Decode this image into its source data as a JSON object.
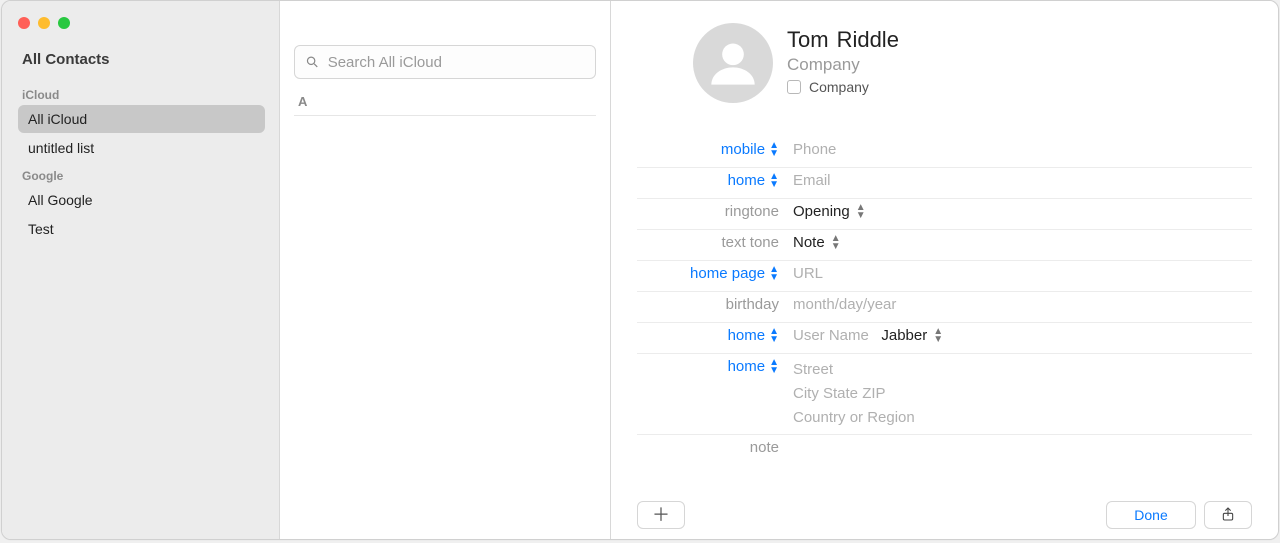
{
  "sidebar": {
    "title": "All Contacts",
    "groups": [
      {
        "name": "iCloud",
        "items": [
          {
            "label": "All iCloud",
            "selected": true
          },
          {
            "label": "untitled list",
            "selected": false
          }
        ]
      },
      {
        "name": "Google",
        "items": [
          {
            "label": "All Google",
            "selected": false
          },
          {
            "label": "Test",
            "selected": false
          }
        ]
      }
    ]
  },
  "search": {
    "placeholder": "Search All iCloud"
  },
  "list": {
    "letter": "A"
  },
  "contact": {
    "first_name": "Tom",
    "last_name": "Riddle",
    "company_placeholder": "Company",
    "is_company_label": "Company",
    "fields": {
      "phone": {
        "label": "mobile",
        "placeholder": "Phone"
      },
      "email": {
        "label": "home",
        "placeholder": "Email"
      },
      "ringtone": {
        "label": "ringtone",
        "value": "Opening"
      },
      "texttone": {
        "label": "text tone",
        "value": "Note"
      },
      "homepage": {
        "label": "home page",
        "placeholder": "URL"
      },
      "birthday": {
        "label": "birthday",
        "placeholder": "month/day/year"
      },
      "im": {
        "label": "home",
        "placeholder": "User Name",
        "service": "Jabber"
      },
      "address": {
        "label": "home",
        "street": "Street",
        "csz": "City State ZIP",
        "country": "Country or Region"
      },
      "note": {
        "label": "note"
      }
    }
  },
  "footer": {
    "done": "Done"
  }
}
